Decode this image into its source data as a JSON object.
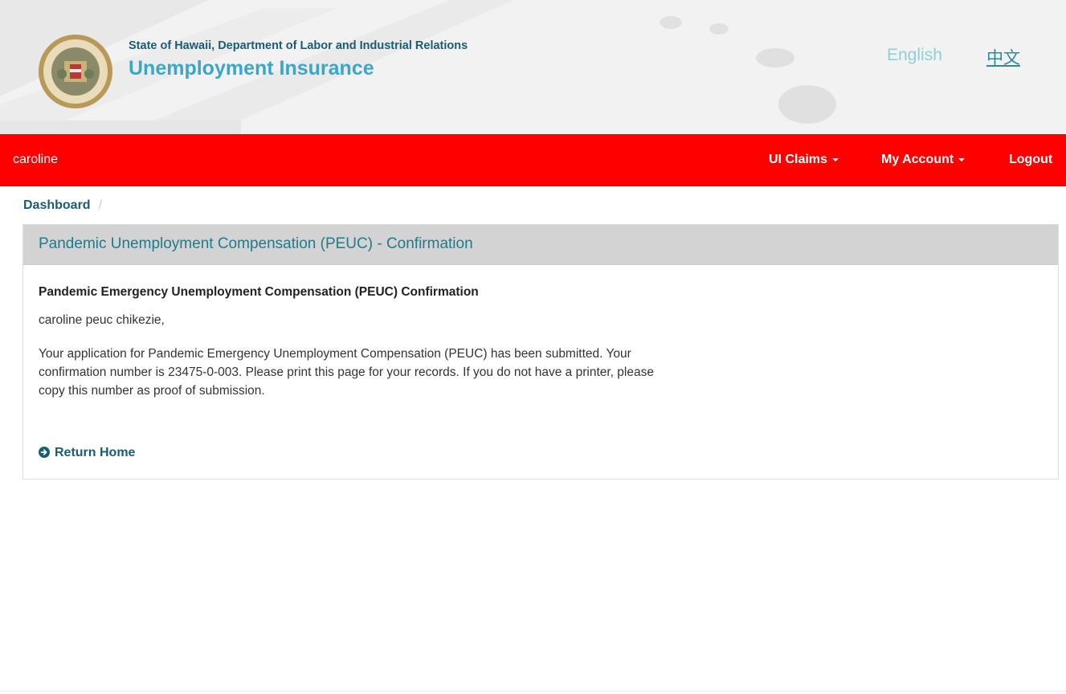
{
  "header": {
    "department": "State of Hawaii, Department of Labor and Industrial Relations",
    "title": "Unemployment Insurance",
    "seal_icon": "state-seal-icon",
    "languages": {
      "english": "English",
      "chinese": "中文"
    }
  },
  "nav": {
    "username": "caroline",
    "ui_claims": "UI Claims",
    "my_account": "My Account",
    "logout": "Logout",
    "bar_color": "#ff0000"
  },
  "breadcrumb": {
    "dashboard": "Dashboard",
    "separator": "/"
  },
  "panel": {
    "heading": "Pandemic Unemployment Compensation (PEUC) - Confirmation",
    "confirmation_title": "Pandemic Emergency Unemployment Compensation (PEUC) Confirmation",
    "greeting": "caroline peuc chikezie,",
    "message": "Your application for Pandemic Emergency Unemployment Compensation (PEUC) has been submitted. Your confirmation number is 23475-0-003. Please print this page for your records. If you do not have a printer, please copy this number as proof of submission.",
    "return_home": "Return Home",
    "return_icon": "arrow-circle-right-icon"
  },
  "colors": {
    "accent": "#1b5c74",
    "title_blue": "#3aa6c8",
    "heading_teal": "#1f7b8c"
  }
}
